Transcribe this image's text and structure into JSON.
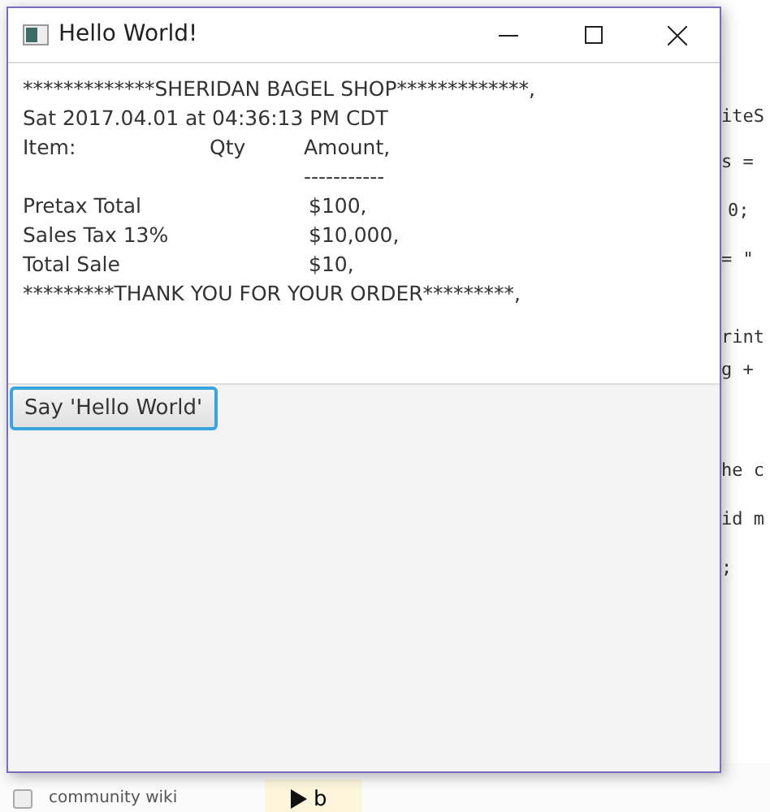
{
  "window": {
    "title": "Hello World!"
  },
  "receipt": {
    "lines": [
      {
        "kind": "full",
        "text": "*************SHERIDAN BAGEL SHOP*************,"
      },
      {
        "kind": "full",
        "text": "Sat 2017.04.01 at 04:36:13 PM CDT"
      },
      {
        "kind": "columns",
        "item": "Item:",
        "qty": "Qty",
        "amount": "Amount,"
      },
      {
        "kind": "rule",
        "amount": "-----------"
      },
      {
        "kind": "total",
        "item": "Pretax Total",
        "amount": "$100,"
      },
      {
        "kind": "total",
        "item": "Sales Tax 13%",
        "amount": "$10,000,"
      },
      {
        "kind": "total",
        "item": "Total Sale",
        "amount": "$10,"
      },
      {
        "kind": "full",
        "text": "*********THANK YOU FOR YOUR ORDER*********,"
      }
    ]
  },
  "button": {
    "label": "Say 'Hello World'"
  },
  "background": {
    "code_lines": [
      "iteS",
      "s = ",
      "0; ",
      "= \"",
      "rint",
      "g + ",
      "he c",
      "id m",
      ";"
    ],
    "checkbox": {
      "label": "community wiki",
      "checked": false
    },
    "run_button": {
      "label": "b"
    }
  }
}
